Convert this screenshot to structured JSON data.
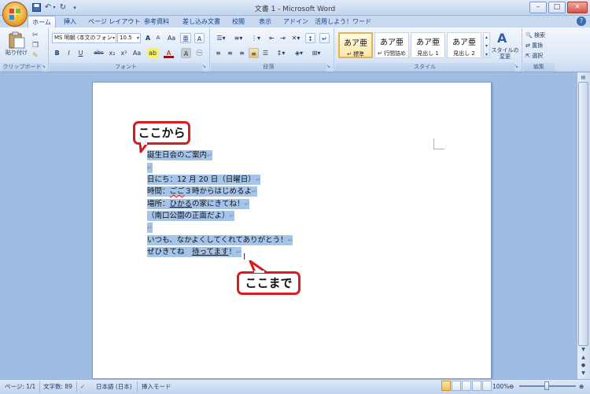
{
  "window": {
    "title": "文書 1 - Microsoft Word",
    "minimize": "–",
    "maximize": "□",
    "close": "×"
  },
  "quick_access": [
    "save-icon",
    "undo-icon",
    "redo-icon",
    "customize-icon"
  ],
  "tabs": [
    "ホーム",
    "挿入",
    "ページ レイアウト",
    "参考資料",
    "差し込み文書",
    "校閲",
    "表示",
    "アドイン",
    "活用しよう！ワード"
  ],
  "active_tab": "ホーム",
  "ribbon": {
    "clipboard": {
      "paste_label": "貼り付け",
      "group_label": "クリップボード"
    },
    "font": {
      "font_name": "MS 明朝 (本文のフォン",
      "font_size": "10.5",
      "group_label": "フォント",
      "buttons_row1": [
        "A",
        "A",
        "Aa",
        "亜",
        "A"
      ],
      "buttons_row2": [
        "B",
        "I",
        "U",
        "abc",
        "x₂",
        "x²",
        "Aa",
        "ab",
        "A",
        "A",
        "㊀"
      ]
    },
    "paragraph": {
      "group_label": "段落"
    },
    "styles": {
      "group_label": "スタイル",
      "items": [
        {
          "sample": "あア亜",
          "name": "↵ 標準"
        },
        {
          "sample": "あア亜",
          "name": "↵ 行間詰め"
        },
        {
          "sample": "あア亜",
          "name": "見出し 1"
        },
        {
          "sample": "あア亜",
          "name": "見出し 2"
        }
      ],
      "change_styles": "スタイルの変更"
    },
    "editing": {
      "group_label": "編集",
      "find": "検索",
      "replace": "置換",
      "select": "選択"
    }
  },
  "document": {
    "lines": [
      "誕生日会のご案内",
      "",
      "日にち：12 月 20 日（日曜日）",
      "時間：ごご３時からはじめるよ",
      "場所：ひかるの家にきてね！",
      "（南口公園の正面だよ）",
      "",
      "いつも、なかよくしてくれてありがとう！",
      "ぜひきてね　待ってます！"
    ],
    "line2_prefix": "時間：",
    "line2_squig": "ごご",
    "line2_suffix": "３時からはじめるよ",
    "line3_prefix": "場所：",
    "line3_uline": "ひかる",
    "line3_suffix": "の家にきてね！",
    "line8_prefix": "ぜひきてね　",
    "line8_uline": "待ってます",
    "line8_suffix": "！",
    "paragraph_mark": "↵"
  },
  "callouts": {
    "start": "ここから",
    "end": "ここまで"
  },
  "status": {
    "page": "ページ: 1/1",
    "words": "文字数: 89",
    "language": "日本語 (日本)",
    "mode": "挿入モード",
    "zoom": "100%"
  },
  "colors": {
    "selection": "#a4c4ea",
    "callout_border": "#d61c1c",
    "ribbon": "#dbe7f6"
  }
}
